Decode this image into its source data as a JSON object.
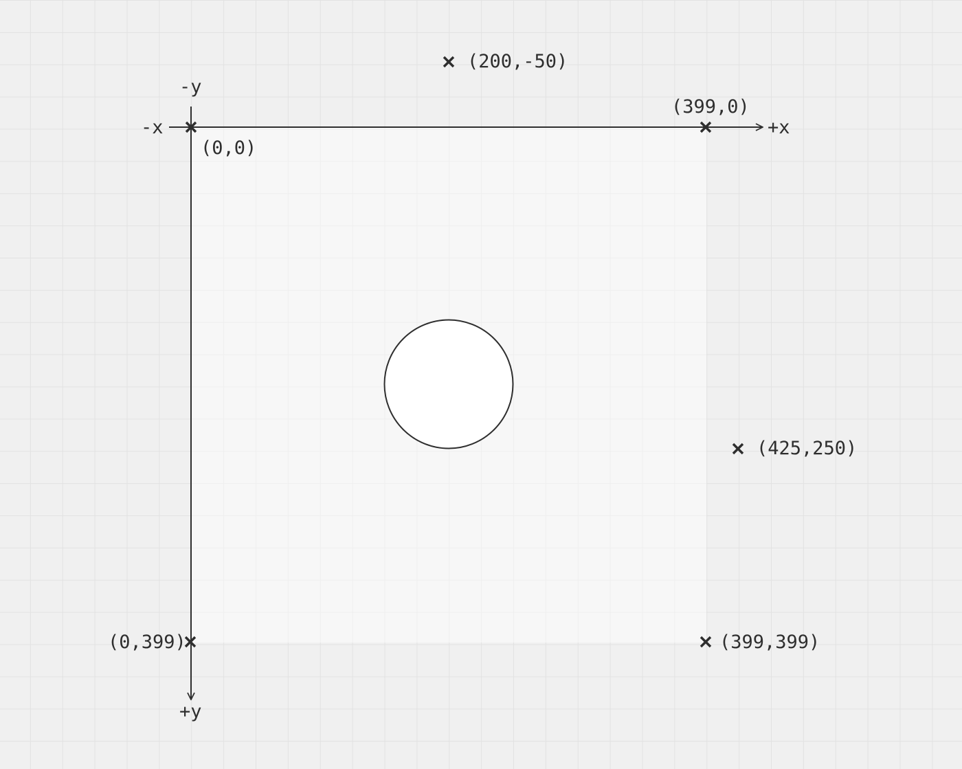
{
  "axes": {
    "neg_x_label": "-x",
    "pos_x_label": "+x",
    "neg_y_label": "-y",
    "pos_y_label": "+y"
  },
  "points": [
    {
      "label": "(0,0)"
    },
    {
      "label": "(399,0)"
    },
    {
      "label": "(200,-50)"
    },
    {
      "label": "(425,250)"
    },
    {
      "label": "(0,399)"
    },
    {
      "label": "(399,399)"
    }
  ],
  "colors": {
    "background": "#f0f0f0",
    "grid": "#e2e2e2",
    "ink": "#2e2e2e",
    "circle_fill": "#ffffff"
  }
}
